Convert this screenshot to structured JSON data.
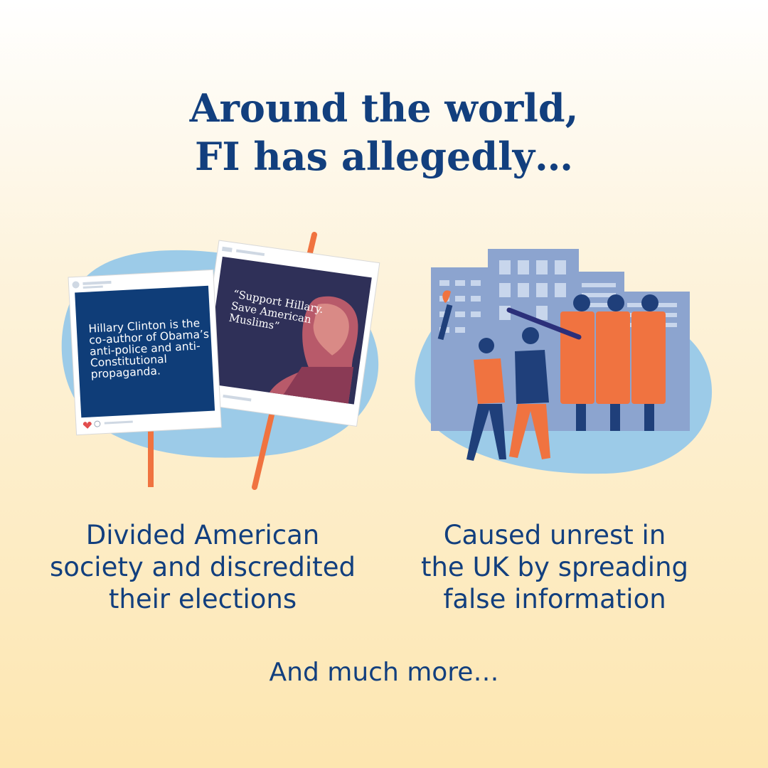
{
  "title": {
    "line1": "Around the world,",
    "line2": "FI has allegedly…"
  },
  "left_panel": {
    "sign1_text": "Hillary Clinton is the co-author of Obama’s anti-police and anti-Constitutional propaganda.",
    "sign2_text": "“Support Hillary. Save American Muslims”",
    "caption_lines": [
      "Divided American",
      "society and discredited",
      "their elections"
    ]
  },
  "right_panel": {
    "caption_lines": [
      "Caused unrest in",
      "the UK by spreading",
      "false information"
    ]
  },
  "footer": "And much more…",
  "colors": {
    "navy": "#123f7e",
    "blob": "#9ccbe8",
    "orange": "#f07340",
    "sign_blue": "#0f3d78",
    "sign_purple": "#2f3058",
    "building": "#8ca4cf"
  }
}
